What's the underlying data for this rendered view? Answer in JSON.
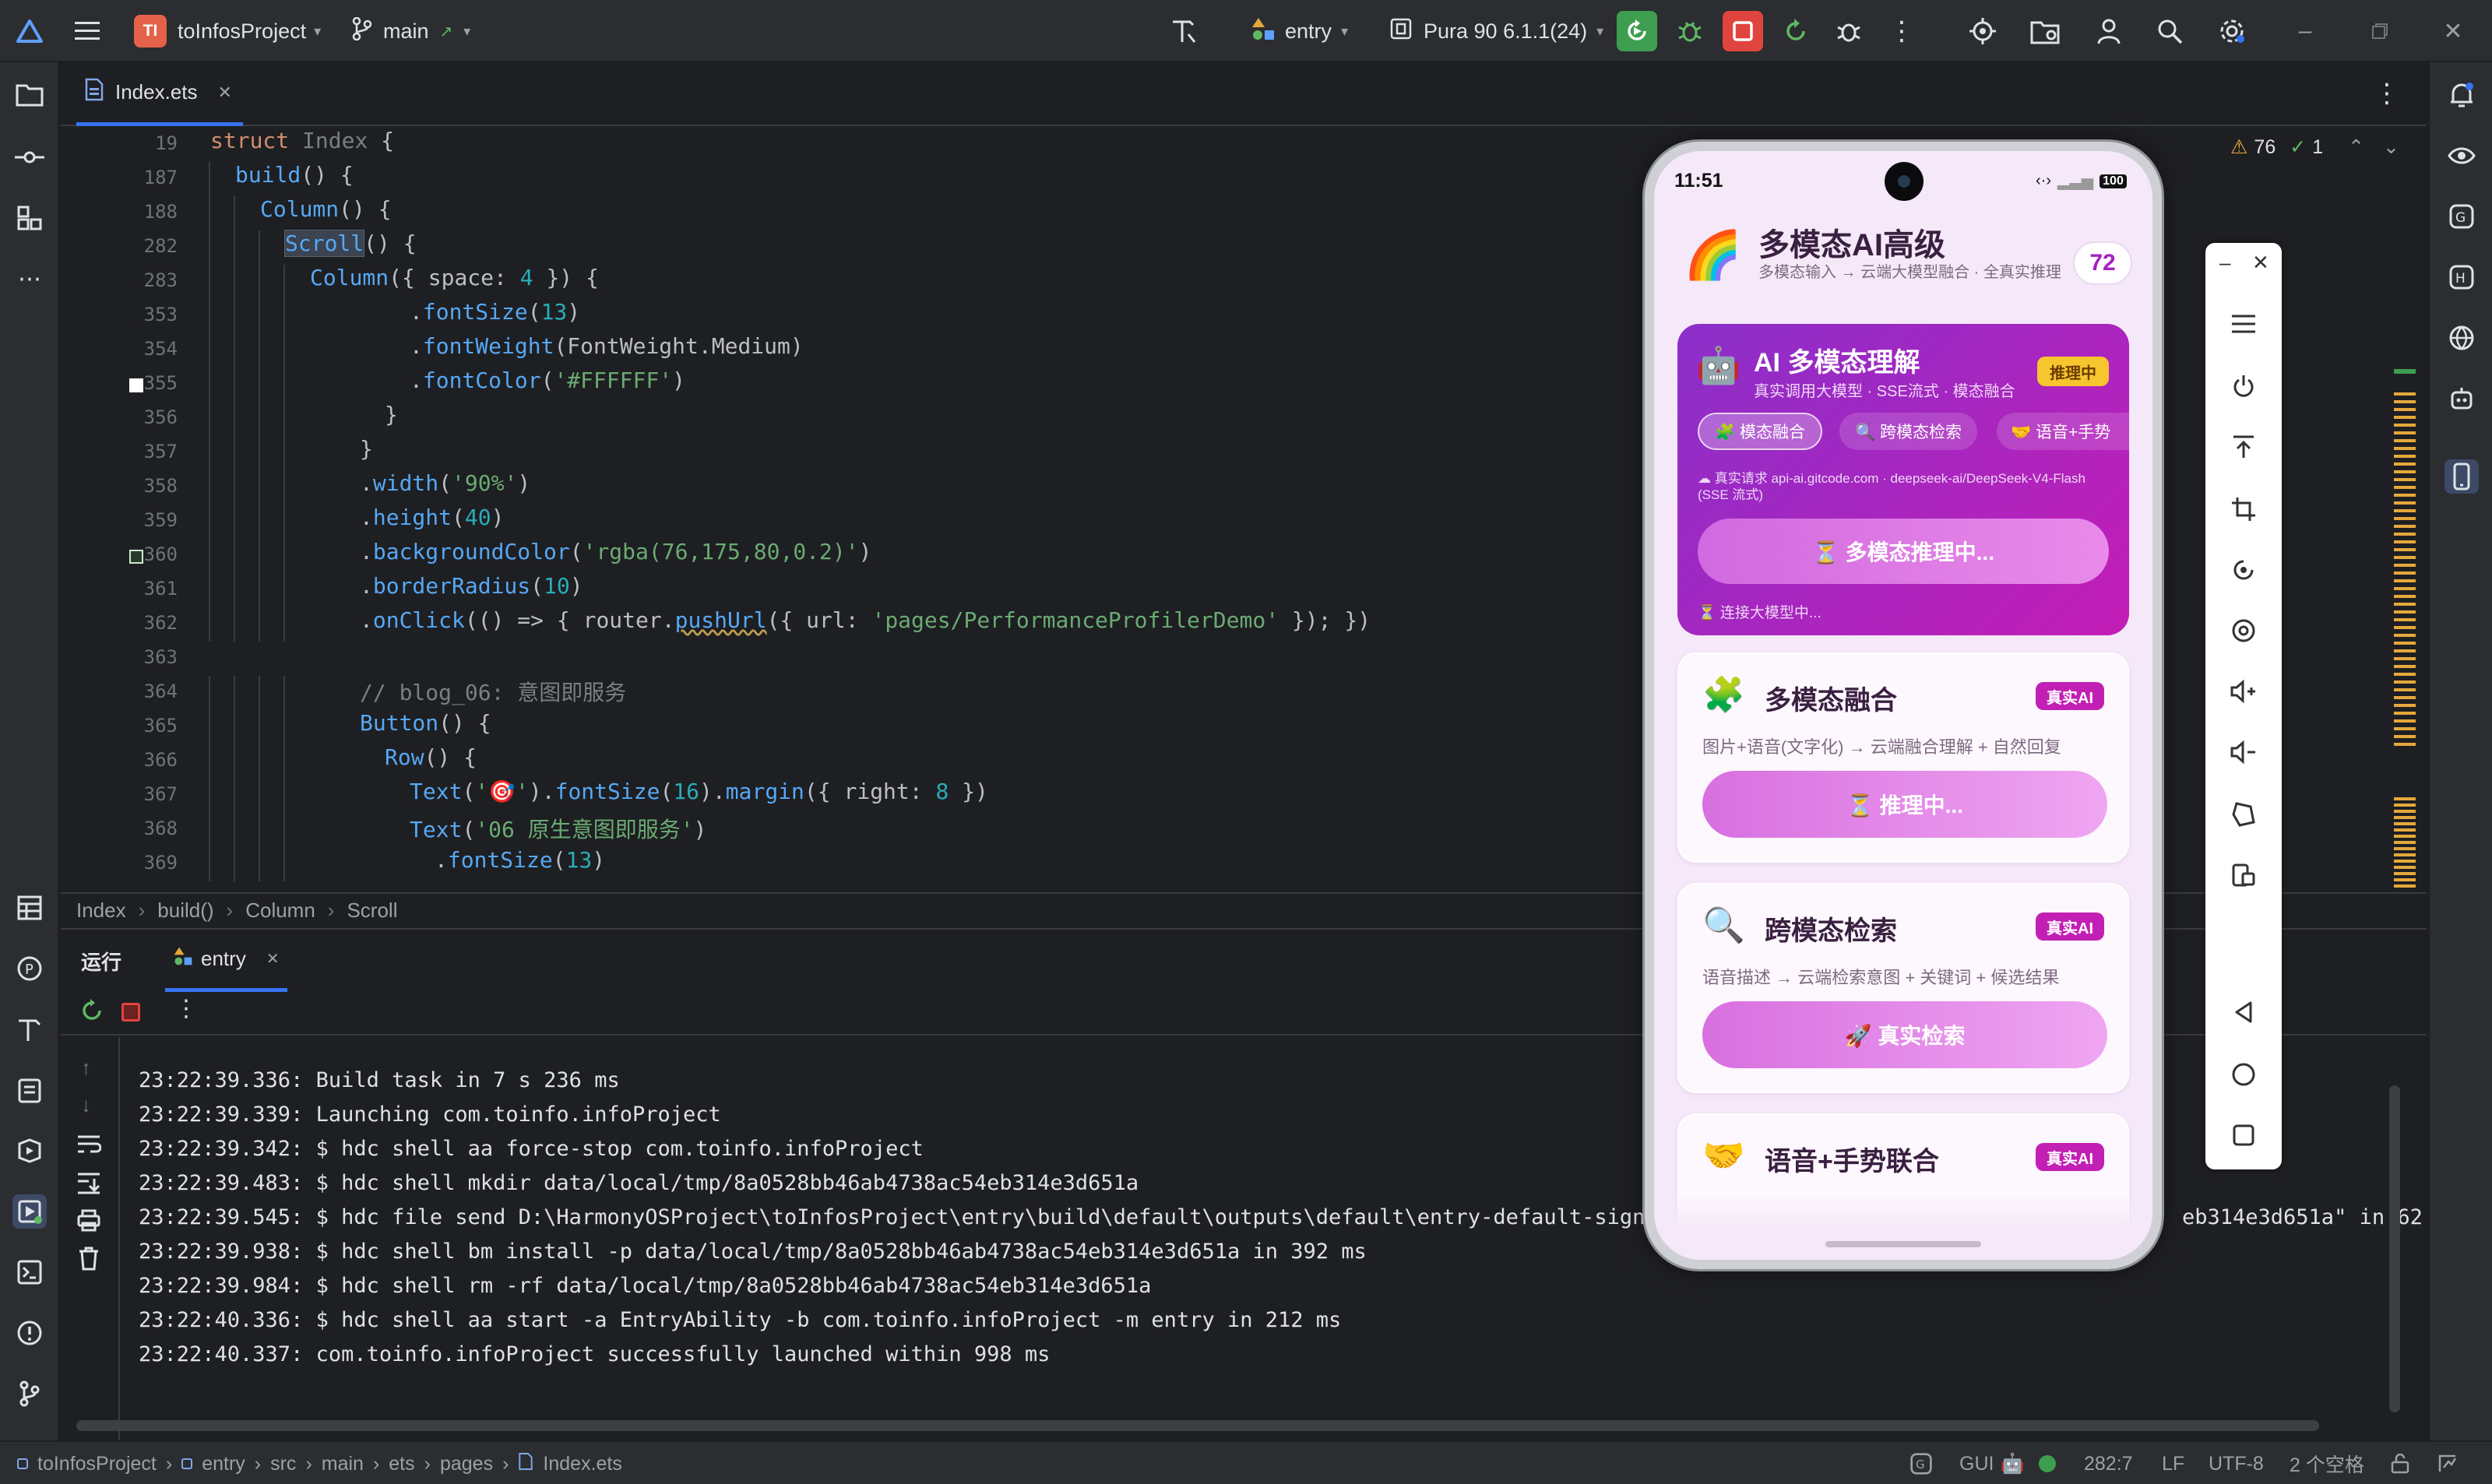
{
  "titlebar": {
    "project_badge": "TI",
    "project_name": "toInfosProject",
    "branch": "main",
    "run_config": "entry",
    "device": "Pura 90 6.1.1(24)"
  },
  "editor": {
    "tab_label": "Index.ets",
    "warnings_count": "76",
    "checks_count": "1",
    "lines": [
      {
        "n": "19",
        "indent": 0,
        "segs": [
          [
            "kw",
            "struct "
          ],
          [
            "gy",
            "Index "
          ],
          [
            "tp",
            "{"
          ]
        ]
      },
      {
        "n": "187",
        "indent": 1,
        "segs": [
          [
            "fn",
            "build"
          ],
          [
            "tp",
            "() {"
          ]
        ]
      },
      {
        "n": "188",
        "indent": 2,
        "segs": [
          [
            "fn",
            "Column"
          ],
          [
            "tp",
            "() {"
          ]
        ]
      },
      {
        "n": "282",
        "indent": 3,
        "segs": [
          [
            "fn",
            "Scroll"
          ],
          [
            "tp",
            "() {"
          ]
        ]
      },
      {
        "n": "283",
        "indent": 4,
        "segs": [
          [
            "fn",
            "Column"
          ],
          [
            "tp",
            "({ space: "
          ],
          [
            "num",
            "4"
          ],
          [
            "tp",
            " }) {"
          ]
        ]
      },
      {
        "n": "353",
        "indent": 8,
        "segs": [
          [
            "tp",
            "."
          ],
          [
            "fn",
            "fontSize"
          ],
          [
            "tp",
            "("
          ],
          [
            "num",
            "13"
          ],
          [
            "tp",
            ")"
          ]
        ]
      },
      {
        "n": "354",
        "indent": 8,
        "segs": [
          [
            "tp",
            "."
          ],
          [
            "fn",
            "fontWeight"
          ],
          [
            "tp",
            "(FontWeight.Medium)"
          ]
        ]
      },
      {
        "n": "355",
        "indent": 8,
        "segs": [
          [
            "tp",
            "."
          ],
          [
            "fn",
            "fontColor"
          ],
          [
            "tp",
            "("
          ],
          [
            "str",
            "'#FFFFFF'"
          ],
          [
            "tp",
            ")"
          ]
        ]
      },
      {
        "n": "356",
        "indent": 7,
        "segs": [
          [
            "tp",
            "}"
          ]
        ]
      },
      {
        "n": "357",
        "indent": 6,
        "segs": [
          [
            "tp",
            "}"
          ]
        ]
      },
      {
        "n": "358",
        "indent": 6,
        "segs": [
          [
            "tp",
            "."
          ],
          [
            "fn",
            "width"
          ],
          [
            "tp",
            "("
          ],
          [
            "str",
            "'90%'"
          ],
          [
            "tp",
            ")"
          ]
        ]
      },
      {
        "n": "359",
        "indent": 6,
        "segs": [
          [
            "tp",
            "."
          ],
          [
            "fn",
            "height"
          ],
          [
            "tp",
            "("
          ],
          [
            "num",
            "40"
          ],
          [
            "tp",
            ")"
          ]
        ]
      },
      {
        "n": "360",
        "indent": 6,
        "segs": [
          [
            "tp",
            "."
          ],
          [
            "fn",
            "backgroundColor"
          ],
          [
            "tp",
            "("
          ],
          [
            "str",
            "'rgba(76,175,80,0.2)'"
          ],
          [
            "tp",
            ")"
          ]
        ]
      },
      {
        "n": "361",
        "indent": 6,
        "segs": [
          [
            "tp",
            "."
          ],
          [
            "fn",
            "borderRadius"
          ],
          [
            "tp",
            "("
          ],
          [
            "num",
            "10"
          ],
          [
            "tp",
            ")"
          ]
        ]
      },
      {
        "n": "362",
        "indent": 6,
        "segs": [
          [
            "tp",
            "."
          ],
          [
            "fn",
            "onClick"
          ],
          [
            "tp",
            "(() => { router."
          ],
          [
            "fn",
            "pushUrl"
          ],
          [
            "tp",
            "({ url: "
          ],
          [
            "str",
            "'pages/PerformanceProfilerDemo'"
          ],
          [
            "tp",
            " }); })"
          ]
        ]
      },
      {
        "n": "363",
        "indent": 0,
        "segs": []
      },
      {
        "n": "364",
        "indent": 6,
        "segs": [
          [
            "cm",
            "// blog_06: 意图即服务"
          ]
        ]
      },
      {
        "n": "365",
        "indent": 6,
        "segs": [
          [
            "fn",
            "Button"
          ],
          [
            "tp",
            "() {"
          ]
        ]
      },
      {
        "n": "366",
        "indent": 7,
        "segs": [
          [
            "fn",
            "Row"
          ],
          [
            "tp",
            "() {"
          ]
        ]
      },
      {
        "n": "367",
        "indent": 8,
        "segs": [
          [
            "fn",
            "Text"
          ],
          [
            "tp",
            "("
          ],
          [
            "str",
            "'🎯'"
          ],
          [
            "tp",
            ")."
          ],
          [
            "fn",
            "fontSize"
          ],
          [
            "tp",
            "("
          ],
          [
            "num",
            "16"
          ],
          [
            "tp",
            ")."
          ],
          [
            "fn",
            "margin"
          ],
          [
            "tp",
            "({ right: "
          ],
          [
            "num",
            "8"
          ],
          [
            "tp",
            " })"
          ]
        ]
      },
      {
        "n": "368",
        "indent": 8,
        "segs": [
          [
            "fn",
            "Text"
          ],
          [
            "tp",
            "("
          ],
          [
            "str",
            "'06 原生意图即服务'"
          ],
          [
            "tp",
            ")"
          ]
        ]
      },
      {
        "n": "369",
        "indent": 9,
        "segs": [
          [
            "tp",
            "."
          ],
          [
            "fn",
            "fontSize"
          ],
          [
            "tp",
            "("
          ],
          [
            "num",
            "13"
          ],
          [
            "tp",
            ")"
          ]
        ]
      }
    ]
  },
  "breadcrumbs": [
    "Index",
    "build()",
    "Column",
    "Scroll"
  ],
  "run_panel": {
    "tab_run": "运行",
    "tab_entry": "entry",
    "log": [
      "23:22:39.336: Build task in 7 s 236 ms",
      "23:22:39.339: Launching com.toinfo.infoProject",
      "23:22:39.342: $ hdc shell aa force-stop com.toinfo.infoProject",
      "23:22:39.483: $ hdc shell mkdir data/local/tmp/8a0528bb46ab4738ac54eb314e3d651a",
      "23:22:39.545: $ hdc file send D:\\HarmonyOSProject\\toInfosProject\\entry\\build\\default\\outputs\\default\\entry-default-signed",
      "23:22:39.938: $ hdc shell bm install -p data/local/tmp/8a0528bb46ab4738ac54eb314e3d651a in 392 ms",
      "23:22:39.984: $ hdc shell rm -rf data/local/tmp/8a0528bb46ab4738ac54eb314e3d651a",
      "23:22:40.336: $ hdc shell aa start -a EntryAbility -b com.toinfo.infoProject -m entry in 212 ms",
      "23:22:40.337: com.toinfo.infoProject successfully launched within 998 ms"
    ],
    "log_tail": "eb314e3d651a\" in 62 ms"
  },
  "statusbar": {
    "path": [
      "toInfosProject",
      "entry",
      "src",
      "main",
      "ets",
      "pages",
      "Index.ets"
    ],
    "gui": "GUI",
    "position": "282:7",
    "line_sep": "LF",
    "encoding": "UTF-8",
    "indent": "2 个空格"
  },
  "phone": {
    "time": "11:51",
    "battery": "100",
    "header_title": "多模态AI高级",
    "header_sub": "多模态输入 → 云端大模型融合 · 全真实推理",
    "score": "72",
    "hero": {
      "title": "AI 多模态理解",
      "sub": "真实调用大模型 · SSE流式 · 模态融合",
      "badge": "推理中",
      "chips": [
        "🧩 模态融合",
        "🔍 跨模态检索",
        "🤝 语音+手势"
      ],
      "request": "☁ 真实请求 api-ai.gitcode.com · deepseek-ai/DeepSeek-V4-Flash (SSE 流式)",
      "button": "⏳ 多模态推理中...",
      "status": "⏳ 连接大模型中..."
    },
    "cards": [
      {
        "title": "多模态融合",
        "tag": "真实AI",
        "desc": "图片+语音(文字化) → 云端融合理解 + 自然回复",
        "button": "⏳ 推理中..."
      },
      {
        "title": "跨模态检索",
        "tag": "真实AI",
        "desc": "语音描述 → 云端检索意图 + 关键词 + 候选结果",
        "button": "🚀 真实检索"
      },
      {
        "title": "语音+手势联合",
        "tag": "真实AI"
      }
    ]
  },
  "colors": {
    "accent": "#3574f0",
    "run_green": "#3d9e4f",
    "stop_red": "#e0443e",
    "hero_purple": "#a620c0",
    "tag_magenta": "#c21fb4"
  }
}
